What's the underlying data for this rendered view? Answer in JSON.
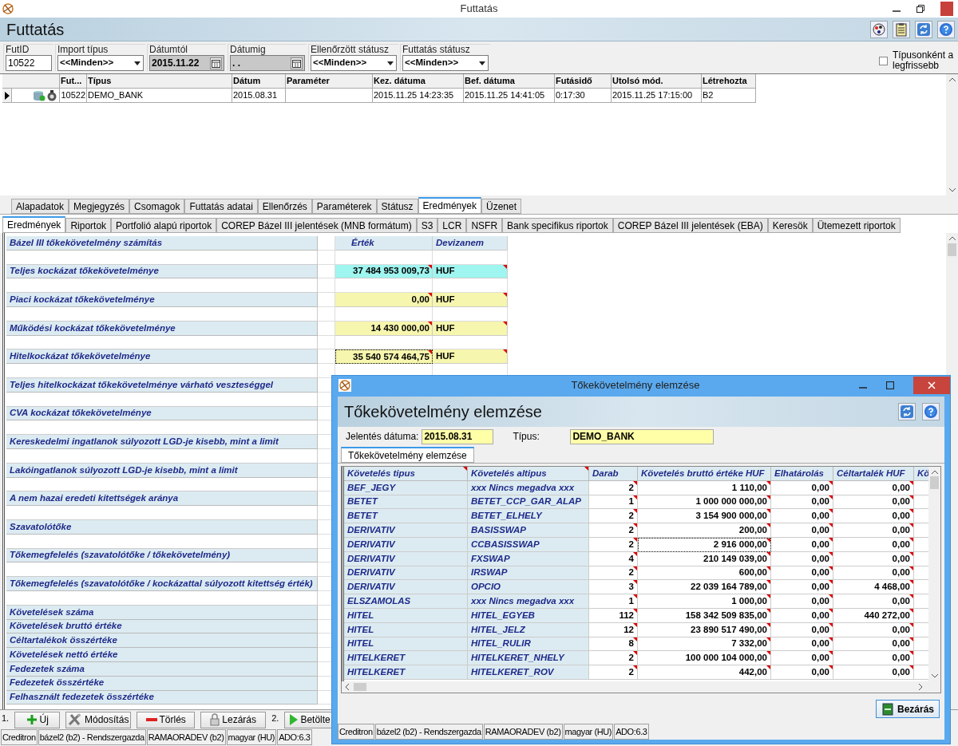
{
  "window": {
    "title": "Futtatás",
    "header_title": "Futtatás"
  },
  "filters": [
    {
      "kind": "text",
      "label": "FutID",
      "value": "10522"
    },
    {
      "kind": "combo",
      "label": "Import típus",
      "value": "<<Minden>>"
    },
    {
      "kind": "date",
      "label": "Dátumtól",
      "value": "2015.11.22"
    },
    {
      "kind": "date",
      "label": "Dátumig",
      "value": ". ."
    },
    {
      "kind": "combo",
      "label": "Ellenőrzött státusz",
      "value": "<<Minden>>"
    },
    {
      "kind": "combo",
      "label": "Futtatás státusz",
      "value": "<<Minden>>"
    }
  ],
  "latest_checkbox": {
    "label": "Típusonként a legfrissebb",
    "checked": false
  },
  "runs": {
    "columns": [
      "Fut...",
      "Típus",
      "Dátum",
      "Paraméter",
      "Kez. dátuma",
      "Bef. dátuma",
      "Futásidő",
      "Utolsó mód.",
      "Létrehozta"
    ],
    "rows": [
      {
        "selected": true,
        "cells": [
          "10522",
          "DEMO_BANK",
          "2015.08.31",
          "",
          "2015.11.25 14:23:35",
          "2015.11.25 14:41:05",
          "0:17:30",
          "2015.11.25 17:15:00",
          "B2"
        ]
      }
    ]
  },
  "tabs": [
    {
      "label": "Alapadatok",
      "selected": false
    },
    {
      "label": "Megjegyzés",
      "selected": false
    },
    {
      "label": "Csomagok",
      "selected": false
    },
    {
      "label": "Futtatás adatai",
      "selected": false
    },
    {
      "label": "Ellenőrzés",
      "selected": false
    },
    {
      "label": "Paraméterek",
      "selected": false
    },
    {
      "label": "Státusz",
      "selected": false
    },
    {
      "label": "Eredmények",
      "selected": true
    },
    {
      "label": "Üzenet",
      "selected": false
    }
  ],
  "subtabs": [
    {
      "label": "Eredmények",
      "selected": true
    },
    {
      "label": "Riportok",
      "selected": false
    },
    {
      "label": "Portfolió alapú riportok",
      "selected": false
    },
    {
      "label": "COREP Bázel III jelentések (MNB formátum)",
      "selected": false
    },
    {
      "label": "S3",
      "selected": false
    },
    {
      "label": "LCR",
      "selected": false
    },
    {
      "label": "NSFR",
      "selected": false
    },
    {
      "label": "Bank specifikus riportok",
      "selected": false
    },
    {
      "label": "COREP Bázel III jelentések (EBA)",
      "selected": false
    },
    {
      "label": "Keresök",
      "selected": false
    },
    {
      "label": "Ütemezett riportok",
      "selected": false
    }
  ],
  "results": {
    "header": {
      "label": "Bázel III tőkekövetelmény számítás",
      "value": "Érték",
      "currency": "Devizanem"
    },
    "rows": [
      {
        "kind": "blank"
      },
      {
        "kind": "item",
        "label": "Teljes kockázat tőkekövetelménye",
        "value": "37 484 953 009,73",
        "currency": "HUF",
        "color": "#9ff5ef",
        "focused": false
      },
      {
        "kind": "blank"
      },
      {
        "kind": "item",
        "label": "Piaci kockázat tőkekövetelménye",
        "value": "0,00",
        "currency": "HUF",
        "color": "#f6f6ae",
        "focused": false
      },
      {
        "kind": "blank"
      },
      {
        "kind": "item",
        "label": "Működési kockázat tőkekövetelménye",
        "value": "14 430 000,00",
        "currency": "HUF",
        "color": "#f6f6ae",
        "focused": false
      },
      {
        "kind": "blank"
      },
      {
        "kind": "item",
        "label": "Hitelkockázat tőkekövetelménye",
        "value": "35 540 574 464,75",
        "currency": "HUF",
        "color": "#f6f6ae",
        "focused": true
      },
      {
        "kind": "blank"
      },
      {
        "kind": "item",
        "label": "Teljes hitelkockázat tőkekövetelménye várható veszteséggel"
      },
      {
        "kind": "blank"
      },
      {
        "kind": "item",
        "label": "CVA kockázat tőkekövetelménye"
      },
      {
        "kind": "blank"
      },
      {
        "kind": "item",
        "label": "Kereskedelmi ingatlanok súlyozott LGD-je kisebb, mint a limit"
      },
      {
        "kind": "blank"
      },
      {
        "kind": "item",
        "label": "Lakóingatlanok súlyozott LGD-je kisebb, mint a limit"
      },
      {
        "kind": "blank"
      },
      {
        "kind": "item",
        "label": "A nem hazai eredeti kitettségek aránya"
      },
      {
        "kind": "blank"
      },
      {
        "kind": "item",
        "label": "Szavatolótőke"
      },
      {
        "kind": "blank"
      },
      {
        "kind": "item",
        "label": "Tőkemegfelelés (szavatolótőke / tőkekövetelmény)"
      },
      {
        "kind": "blank"
      },
      {
        "kind": "item",
        "label": "Tőkemegfelelés (szavatolótőke / kockázattal súlyozott kitettség érték)"
      },
      {
        "kind": "blank"
      },
      {
        "kind": "item",
        "label": "Követelések száma"
      },
      {
        "kind": "item",
        "label": "Követelések bruttó értéke"
      },
      {
        "kind": "item",
        "label": "Céltartalékok összértéke"
      },
      {
        "kind": "item",
        "label": "Követelések nettó értéke"
      },
      {
        "kind": "item",
        "label": "Fedezetek száma"
      },
      {
        "kind": "item",
        "label": "Fedezetek összértéke"
      },
      {
        "kind": "item",
        "label": "Felhasznált fedezetek összértéke"
      }
    ]
  },
  "buttons": [
    {
      "kind": "step",
      "label": "1."
    },
    {
      "kind": "add",
      "label": "Új"
    },
    {
      "kind": "edit",
      "label": "Módosítás"
    },
    {
      "kind": "delete",
      "label": "Törlés"
    },
    {
      "kind": "lock",
      "label": "Lezárás"
    },
    {
      "kind": "step",
      "label": "2."
    },
    {
      "kind": "run",
      "label": "Betölte"
    }
  ],
  "status_bar": [
    "Creditron",
    "bázel2 (b2) - Rendszergazda",
    "RAMAORADEV (b2)",
    "magyar (HU)",
    "ADO:6.3"
  ],
  "dialog": {
    "title": "Tőkekövetelmény elemzése",
    "header_title": "Tőkekövetelmény elemzése",
    "fields": [
      {
        "label": "Jelentés dátuma:",
        "value": "2015.08.31"
      },
      {
        "label": "Típus:",
        "value": "DEMO_BANK"
      }
    ],
    "tabs": [
      {
        "label": "Tőkekövetelmény elemzése",
        "selected": true
      }
    ],
    "columns": [
      "Követelés tipus",
      "Követelés altipus",
      "Darab",
      "Követelés bruttó értéke HUF",
      "Elhatárolás",
      "Céltartalék HUF",
      "Kö"
    ],
    "rows": [
      {
        "focused": false,
        "cells": [
          "BEF_JEGY",
          "xxx Nincs megadva xxx",
          "2",
          "1 110,00",
          "0,00",
          "0,00"
        ]
      },
      {
        "focused": false,
        "cells": [
          "BETET",
          "BETET_CCP_GAR_ALAP",
          "1",
          "1 000 000 000,00",
          "0,00",
          "0,00"
        ]
      },
      {
        "focused": false,
        "cells": [
          "BETET",
          "BETET_ELHELY",
          "2",
          "3 154 900 000,00",
          "0,00",
          "0,00"
        ]
      },
      {
        "focused": false,
        "cells": [
          "DERIVATIV",
          "BASISSWAP",
          "2",
          "200,00",
          "0,00",
          "0,00"
        ]
      },
      {
        "focused": true,
        "cells": [
          "DERIVATIV",
          "CCBASISSWAP",
          "2",
          "2 916 000,00",
          "0,00",
          "0,00"
        ]
      },
      {
        "focused": false,
        "cells": [
          "DERIVATIV",
          "FXSWAP",
          "4",
          "210 149 039,00",
          "0,00",
          "0,00"
        ]
      },
      {
        "focused": false,
        "cells": [
          "DERIVATIV",
          "IRSWAP",
          "2",
          "600,00",
          "0,00",
          "0,00"
        ]
      },
      {
        "focused": false,
        "cells": [
          "DERIVATIV",
          "OPCIO",
          "3",
          "22 039 164 789,00",
          "0,00",
          "4 468,00"
        ]
      },
      {
        "focused": false,
        "cells": [
          "ELSZAMOLAS",
          "xxx Nincs megadva xxx",
          "1",
          "1 000,00",
          "0,00",
          "0,00"
        ]
      },
      {
        "focused": false,
        "cells": [
          "HITEL",
          "HITEL_EGYEB",
          "112",
          "158 342 509 835,00",
          "0,00",
          "440 272,00"
        ]
      },
      {
        "focused": false,
        "cells": [
          "HITEL",
          "HITEL_JELZ",
          "12",
          "23 890 517 490,00",
          "0,00",
          "0,00"
        ]
      },
      {
        "focused": false,
        "cells": [
          "HITEL",
          "HITEL_RULIR",
          "8",
          "7 332,00",
          "0,00",
          "0,00"
        ]
      },
      {
        "focused": false,
        "cells": [
          "HITELKERET",
          "HITELKERET_NHELY",
          "2",
          "100 000 104 000,00",
          "0,00",
          "0,00"
        ]
      },
      {
        "focused": false,
        "cells": [
          "HITELKERET",
          "HITELKERET_ROV",
          "2",
          "442,00",
          "0,00",
          "0,00"
        ]
      }
    ],
    "close_button": "Bezárás",
    "status_bar": [
      "Creditron",
      "bázel2 (b2) - Rendszergazda",
      "RAMAORADEV (b2)",
      "magyar (HU)",
      "ADO:6.3"
    ]
  }
}
